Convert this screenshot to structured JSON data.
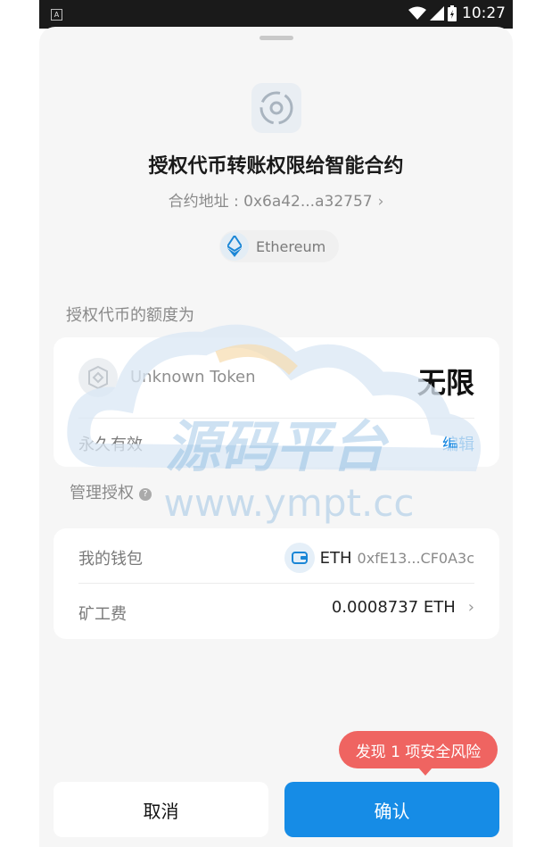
{
  "status_bar": {
    "time": "10:27",
    "left_badge": "A"
  },
  "title": "授权代币转账权限给智能合约",
  "contract": {
    "label": "合约地址 : 0x6a42...a32757"
  },
  "network": {
    "name": "Ethereum"
  },
  "allowance": {
    "section_label": "授权代币的额度为",
    "token_name": "Unknown Token",
    "amount": "无限",
    "validity": "永久有效",
    "edit_label": "编辑"
  },
  "manage": {
    "section_label": "管理授权",
    "help_glyph": "?"
  },
  "wallet": {
    "label": "我的钱包",
    "chain": "ETH",
    "address": "0xfE13...CF0A3c"
  },
  "fee": {
    "label": "矿工费",
    "value": "0.0008737 ETH"
  },
  "risk_tip": "发现 1 项安全风险",
  "buttons": {
    "cancel": "取消",
    "confirm": "确认"
  },
  "watermark": {
    "main": "源码平台",
    "url": "www.ympt.cc"
  },
  "colors": {
    "accent": "#168ce6",
    "risk": "#ef6461",
    "link": "#1486e0",
    "sheet_bg": "#f6f6f6"
  },
  "icons": [
    "wifi-icon",
    "signal-icon",
    "battery-icon",
    "contract-icon",
    "ethereum-icon",
    "token-icon",
    "help-icon",
    "wallet-icon",
    "chevron-right-icon"
  ]
}
